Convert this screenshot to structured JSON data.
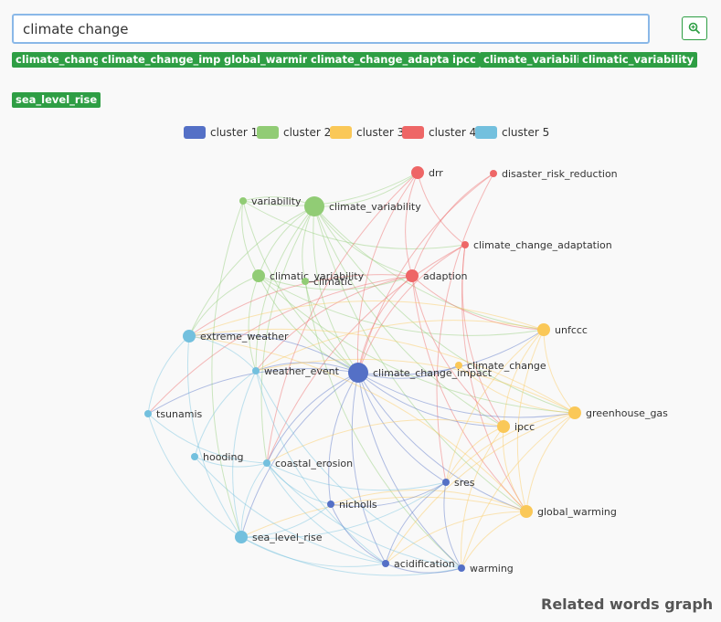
{
  "search": {
    "value": "climate change"
  },
  "tags": [
    "climate_change",
    "climate_change_impact",
    "global_warming",
    "climate_change_adaptation",
    "ipcc",
    "climate_variability",
    "climatic_variability",
    "sea_level_rise"
  ],
  "legend": [
    {
      "label": "cluster 1",
      "color": "#5470c6"
    },
    {
      "label": "cluster 2",
      "color": "#91cc75"
    },
    {
      "label": "cluster 3",
      "color": "#fac858"
    },
    {
      "label": "cluster 4",
      "color": "#ee6666"
    },
    {
      "label": "cluster 5",
      "color": "#73c0de"
    }
  ],
  "graph": {
    "nodes": [
      {
        "label": "drr",
        "cluster": 4,
        "size": "medium"
      },
      {
        "label": "disaster_risk_reduction",
        "cluster": 4,
        "size": "small"
      },
      {
        "label": "variability",
        "cluster": 2,
        "size": "small"
      },
      {
        "label": "climate_variability",
        "cluster": 2,
        "size": "large"
      },
      {
        "label": "climate_change_adaptation",
        "cluster": 4,
        "size": "small"
      },
      {
        "label": "climatic_variability",
        "cluster": 2,
        "size": "medium"
      },
      {
        "label": "climatic",
        "cluster": 2,
        "size": "small"
      },
      {
        "label": "adaption",
        "cluster": 4,
        "size": "medium"
      },
      {
        "label": "unfccc",
        "cluster": 3,
        "size": "medium"
      },
      {
        "label": "extreme_weather",
        "cluster": 5,
        "size": "medium"
      },
      {
        "label": "weather_event",
        "cluster": 5,
        "size": "small"
      },
      {
        "label": "climate_change_impact",
        "cluster": 1,
        "size": "large"
      },
      {
        "label": "climate_change",
        "cluster": 3,
        "size": "small"
      },
      {
        "label": "tsunamis",
        "cluster": 5,
        "size": "small"
      },
      {
        "label": "greenhouse_gas",
        "cluster": 3,
        "size": "medium"
      },
      {
        "label": "ipcc",
        "cluster": 3,
        "size": "medium"
      },
      {
        "label": "hooding",
        "cluster": 5,
        "size": "small"
      },
      {
        "label": "coastal_erosion",
        "cluster": 5,
        "size": "small"
      },
      {
        "label": "sres",
        "cluster": 1,
        "size": "small"
      },
      {
        "label": "nicholls",
        "cluster": 1,
        "size": "small"
      },
      {
        "label": "global_warming",
        "cluster": 3,
        "size": "medium"
      },
      {
        "label": "sea_level_rise",
        "cluster": 5,
        "size": "medium"
      },
      {
        "label": "acidification",
        "cluster": 1,
        "size": "small"
      },
      {
        "label": "warming",
        "cluster": 1,
        "size": "small"
      }
    ],
    "edges": [
      [
        "climate_variability",
        "variability"
      ],
      [
        "climate_variability",
        "climatic_variability"
      ],
      [
        "climate_variability",
        "climatic"
      ],
      [
        "climate_variability",
        "drr"
      ],
      [
        "climate_variability",
        "adaption"
      ],
      [
        "climate_variability",
        "climate_change_impact"
      ],
      [
        "climate_variability",
        "extreme_weather"
      ],
      [
        "climate_variability",
        "weather_event"
      ],
      [
        "climate_variability",
        "coastal_erosion"
      ],
      [
        "climate_variability",
        "unfccc"
      ],
      [
        "climate_variability",
        "ipcc"
      ],
      [
        "climate_variability",
        "global_warming"
      ],
      [
        "climate_variability",
        "greenhouse_gas"
      ],
      [
        "variability",
        "climatic_variability"
      ],
      [
        "variability",
        "drr"
      ],
      [
        "variability",
        "climate_change_impact"
      ],
      [
        "variability",
        "climate_change_adaptation"
      ],
      [
        "climatic_variability",
        "adaption"
      ],
      [
        "climatic_variability",
        "extreme_weather"
      ],
      [
        "climatic_variability",
        "climate_change_impact"
      ],
      [
        "climatic_variability",
        "weather_event"
      ],
      [
        "climatic_variability",
        "unfccc"
      ],
      [
        "climatic_variability",
        "greenhouse_gas"
      ],
      [
        "climatic",
        "climate_change_impact"
      ],
      [
        "climatic",
        "warming"
      ],
      [
        "drr",
        "adaption"
      ],
      [
        "drr",
        "climate_change_impact"
      ],
      [
        "drr",
        "coastal_erosion"
      ],
      [
        "drr",
        "climate_change_adaptation"
      ],
      [
        "disaster_risk_reduction",
        "climate_change_impact"
      ],
      [
        "disaster_risk_reduction",
        "sres"
      ],
      [
        "disaster_risk_reduction",
        "adaption"
      ],
      [
        "climate_change_adaptation",
        "climate_change_impact"
      ],
      [
        "climate_change_adaptation",
        "ipcc"
      ],
      [
        "climate_change_adaptation",
        "global_warming"
      ],
      [
        "climate_change_adaptation",
        "coastal_erosion"
      ],
      [
        "adaption",
        "climate_change_impact"
      ],
      [
        "adaption",
        "extreme_weather"
      ],
      [
        "adaption",
        "unfccc"
      ],
      [
        "adaption",
        "ipcc"
      ],
      [
        "adaption",
        "tsunamis"
      ],
      [
        "adaption",
        "weather_event"
      ],
      [
        "adaption",
        "global_warming"
      ],
      [
        "climate_change_impact",
        "unfccc"
      ],
      [
        "climate_change_impact",
        "climate_change"
      ],
      [
        "climate_change_impact",
        "greenhouse_gas"
      ],
      [
        "climate_change_impact",
        "ipcc"
      ],
      [
        "climate_change_impact",
        "sres"
      ],
      [
        "climate_change_impact",
        "global_warming"
      ],
      [
        "climate_change_impact",
        "nicholls"
      ],
      [
        "climate_change_impact",
        "acidification"
      ],
      [
        "climate_change_impact",
        "warming"
      ],
      [
        "climate_change_impact",
        "sea_level_rise"
      ],
      [
        "climate_change_impact",
        "coastal_erosion"
      ],
      [
        "climate_change_impact",
        "extreme_weather"
      ],
      [
        "climate_change_impact",
        "weather_event"
      ],
      [
        "climate_change_impact",
        "tsunamis"
      ],
      [
        "unfccc",
        "ipcc"
      ],
      [
        "unfccc",
        "greenhouse_gas"
      ],
      [
        "unfccc",
        "global_warming"
      ],
      [
        "unfccc",
        "weather_event"
      ],
      [
        "unfccc",
        "sres"
      ],
      [
        "unfccc",
        "extreme_weather"
      ],
      [
        "greenhouse_gas",
        "global_warming"
      ],
      [
        "greenhouse_gas",
        "warming"
      ],
      [
        "greenhouse_gas",
        "acidification"
      ],
      [
        "greenhouse_gas",
        "sres"
      ],
      [
        "greenhouse_gas",
        "extreme_weather"
      ],
      [
        "greenhouse_gas",
        "weather_event"
      ],
      [
        "ipcc",
        "global_warming"
      ],
      [
        "ipcc",
        "sres"
      ],
      [
        "ipcc",
        "warming"
      ],
      [
        "ipcc",
        "coastal_erosion"
      ],
      [
        "global_warming",
        "warming"
      ],
      [
        "global_warming",
        "acidification"
      ],
      [
        "global_warming",
        "sea_level_rise"
      ],
      [
        "global_warming",
        "extreme_weather"
      ],
      [
        "global_warming",
        "nicholls"
      ],
      [
        "weather_event",
        "extreme_weather"
      ],
      [
        "weather_event",
        "hooding"
      ],
      [
        "weather_event",
        "sea_level_rise"
      ],
      [
        "weather_event",
        "acidification"
      ],
      [
        "weather_event",
        "warming"
      ],
      [
        "extreme_weather",
        "tsunamis"
      ],
      [
        "extreme_weather",
        "sea_level_rise"
      ],
      [
        "tsunamis",
        "coastal_erosion"
      ],
      [
        "tsunamis",
        "sea_level_rise"
      ],
      [
        "hooding",
        "coastal_erosion"
      ],
      [
        "hooding",
        "acidification"
      ],
      [
        "coastal_erosion",
        "sea_level_rise"
      ],
      [
        "coastal_erosion",
        "acidification"
      ],
      [
        "coastal_erosion",
        "nicholls"
      ],
      [
        "coastal_erosion",
        "warming"
      ],
      [
        "coastal_erosion",
        "sres"
      ],
      [
        "sea_level_rise",
        "acidification"
      ],
      [
        "sea_level_rise",
        "nicholls"
      ],
      [
        "sea_level_rise",
        "sres"
      ],
      [
        "sea_level_rise",
        "warming"
      ],
      [
        "nicholls",
        "sres"
      ],
      [
        "nicholls",
        "acidification"
      ],
      [
        "sres",
        "warming"
      ],
      [
        "sres",
        "acidification"
      ],
      [
        "acidification",
        "warming"
      ],
      [
        "variability",
        "sea_level_rise"
      ],
      [
        "climate_change",
        "greenhouse_gas"
      ]
    ]
  },
  "caption": "Related words graph"
}
